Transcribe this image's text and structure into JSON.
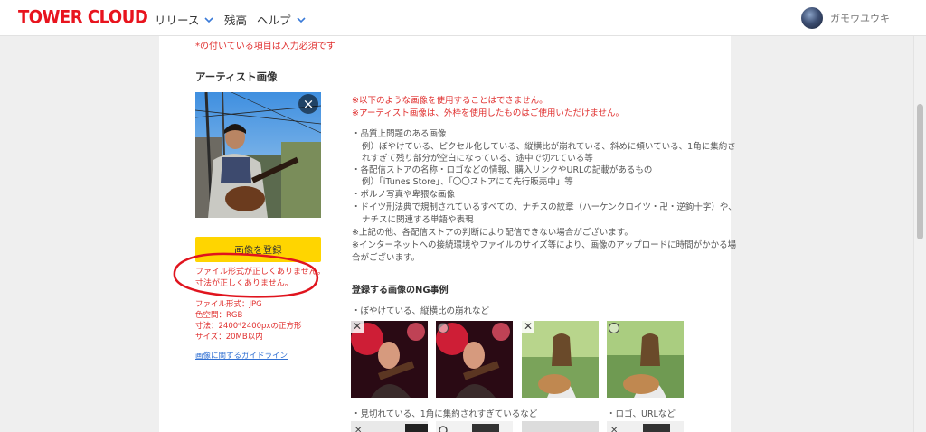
{
  "header": {
    "logo": "TOWER CLOUD",
    "nav": [
      {
        "label": "リリース",
        "has_dropdown": true
      },
      {
        "label": "残高",
        "has_dropdown": false
      },
      {
        "label": "ヘルプ",
        "has_dropdown": true
      }
    ],
    "user_name": "ガモウユウキ"
  },
  "form": {
    "required_note": "*の付いている項目は入力必須です",
    "section_title": "アーティスト画像",
    "upload_button": "画像を登録",
    "errors": [
      "ファイル形式が正しくありません。",
      "寸法が正しくありません。"
    ],
    "specs": [
      "ファイル形式：JPG",
      "色空間：RGB",
      "寸法：2400*2400pxの正方形",
      "サイズ：20MB以内"
    ],
    "guide_link": "画像に関するガイドライン"
  },
  "guidelines": {
    "warnings": [
      "※以下のような画像を使用することはできません。",
      "※アーティスト画像は、外枠を使用したものはご使用いただけません。"
    ],
    "rules": [
      "・品質上問題のある画像",
      "例）ぼやけている、ピクセル化している、縦横比が崩れている、斜めに傾いている、1角に集約さ",
      "れすぎて残り部分が空白になっている、途中で切れている等",
      "・各配信ストアの名称・ロゴなどの情報、購入リンクやURLの記載があるもの",
      "例）「iTunes Store」、「〇〇ストアにて先行販売中」等",
      "・ポルノ写真や卑猥な画像",
      "・ドイツ刑法典で規制されているすべての、ナチスの紋章（ハーケンクロイツ・卍・逆鉤十字）や、",
      "ナチスに関連する単語や表現",
      "※上記の他、各配信ストアの判断により配信できない場合がございます。",
      "※インターネットへの接続環境やファイルのサイズ等により、画像のアップロードに時間がかかる場",
      "合がございます。"
    ],
    "ng_title": "登録する画像のNG事例",
    "ng_sub1": "・ぼやけている、縦横比の崩れなど",
    "ng_sub2": "・見切れている、1角に集約されすぎているなど",
    "ng_sub3": "・ロゴ、URLなど",
    "examples": [
      {
        "mark": "ng"
      },
      {
        "mark": "ok"
      },
      {
        "mark": "ng"
      },
      {
        "mark": "ok"
      }
    ]
  },
  "colors": {
    "brand": "#e8141e",
    "accent_button": "#ffd500",
    "error": "#e0302f",
    "link": "#2f6fd2"
  },
  "icons": {
    "close": "close-icon",
    "chevron": "chevron-down-icon"
  }
}
